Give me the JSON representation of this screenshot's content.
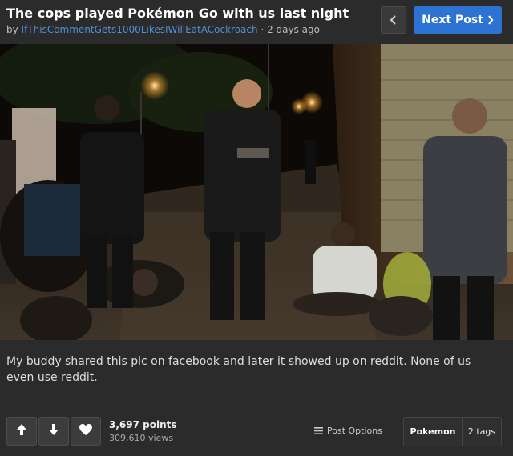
{
  "post": {
    "title": "The cops played Pokémon Go with us last night",
    "by_prefix": "by",
    "author": "IfThisCommentGets1000LikesIWillEatACockroach",
    "time": "· 2 days ago",
    "description": "My buddy shared this pic on facebook and later it showed up on reddit. None of us even use reddit."
  },
  "nav": {
    "prev_icon": "chevron-left-icon",
    "next_label": "Next Post",
    "next_icon": "chevron-right-icon"
  },
  "photo": {
    "icon": "night-street-photo"
  },
  "stats": {
    "points": "3,697 points",
    "views": "309,610 views"
  },
  "actions": {
    "upvote_icon": "arrow-up-icon",
    "downvote_icon": "arrow-down-icon",
    "favorite_icon": "heart-icon",
    "options_icon": "menu-icon",
    "options_label": "Post Options"
  },
  "tags": {
    "first": "Pokemon",
    "count": "2 tags"
  },
  "colors": {
    "background": "#2b2b2b",
    "accent": "#2d73d3",
    "author_link": "#4d90d8"
  }
}
